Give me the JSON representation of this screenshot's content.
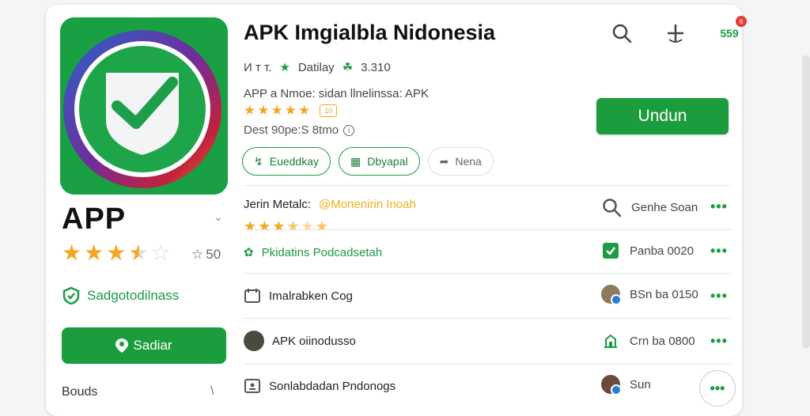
{
  "app": {
    "name": "APP",
    "fav_count": "50",
    "safety_label": "Sadgotodilnass",
    "left_button_label": "Sadiar",
    "bottom_label": "Bouds",
    "bottom_arrow": "\\"
  },
  "header": {
    "title": "APK Imgialbla Nidonesia",
    "notification_count": "559",
    "badge_text": "6"
  },
  "meta": {
    "m1": "И т т.",
    "m2": "Datilay",
    "m3": "3.310"
  },
  "details": {
    "subtitle": "APP a Nmoe: sidan llnelinssa: APK",
    "rating_stars": 5,
    "badge": "10",
    "desc": "Dest 90pe:S 8tmo"
  },
  "install_button": "Undun",
  "chips": [
    {
      "label": "Eueddkay"
    },
    {
      "label": "Dbyapal"
    },
    {
      "label": "Nena"
    }
  ],
  "rows": [
    {
      "label": "Jerin Metalc:",
      "highlight": "@Monenirin Inoah",
      "right": "Genhe Soan",
      "stars": 4
    },
    {
      "label": "Pkidatins Podcadsetah",
      "right": "Panba 0020"
    },
    {
      "label": "Imalrabken Cog",
      "right": "BSn ba 0150"
    },
    {
      "label": "APK oiinodusso",
      "right": "Crn ba 0800"
    },
    {
      "label": "Sonlabdadan Pndonogs",
      "right": "Sun"
    }
  ],
  "more_label": "•••",
  "colors": {
    "accent": "#1b9c3d",
    "star": "#f5a623"
  }
}
